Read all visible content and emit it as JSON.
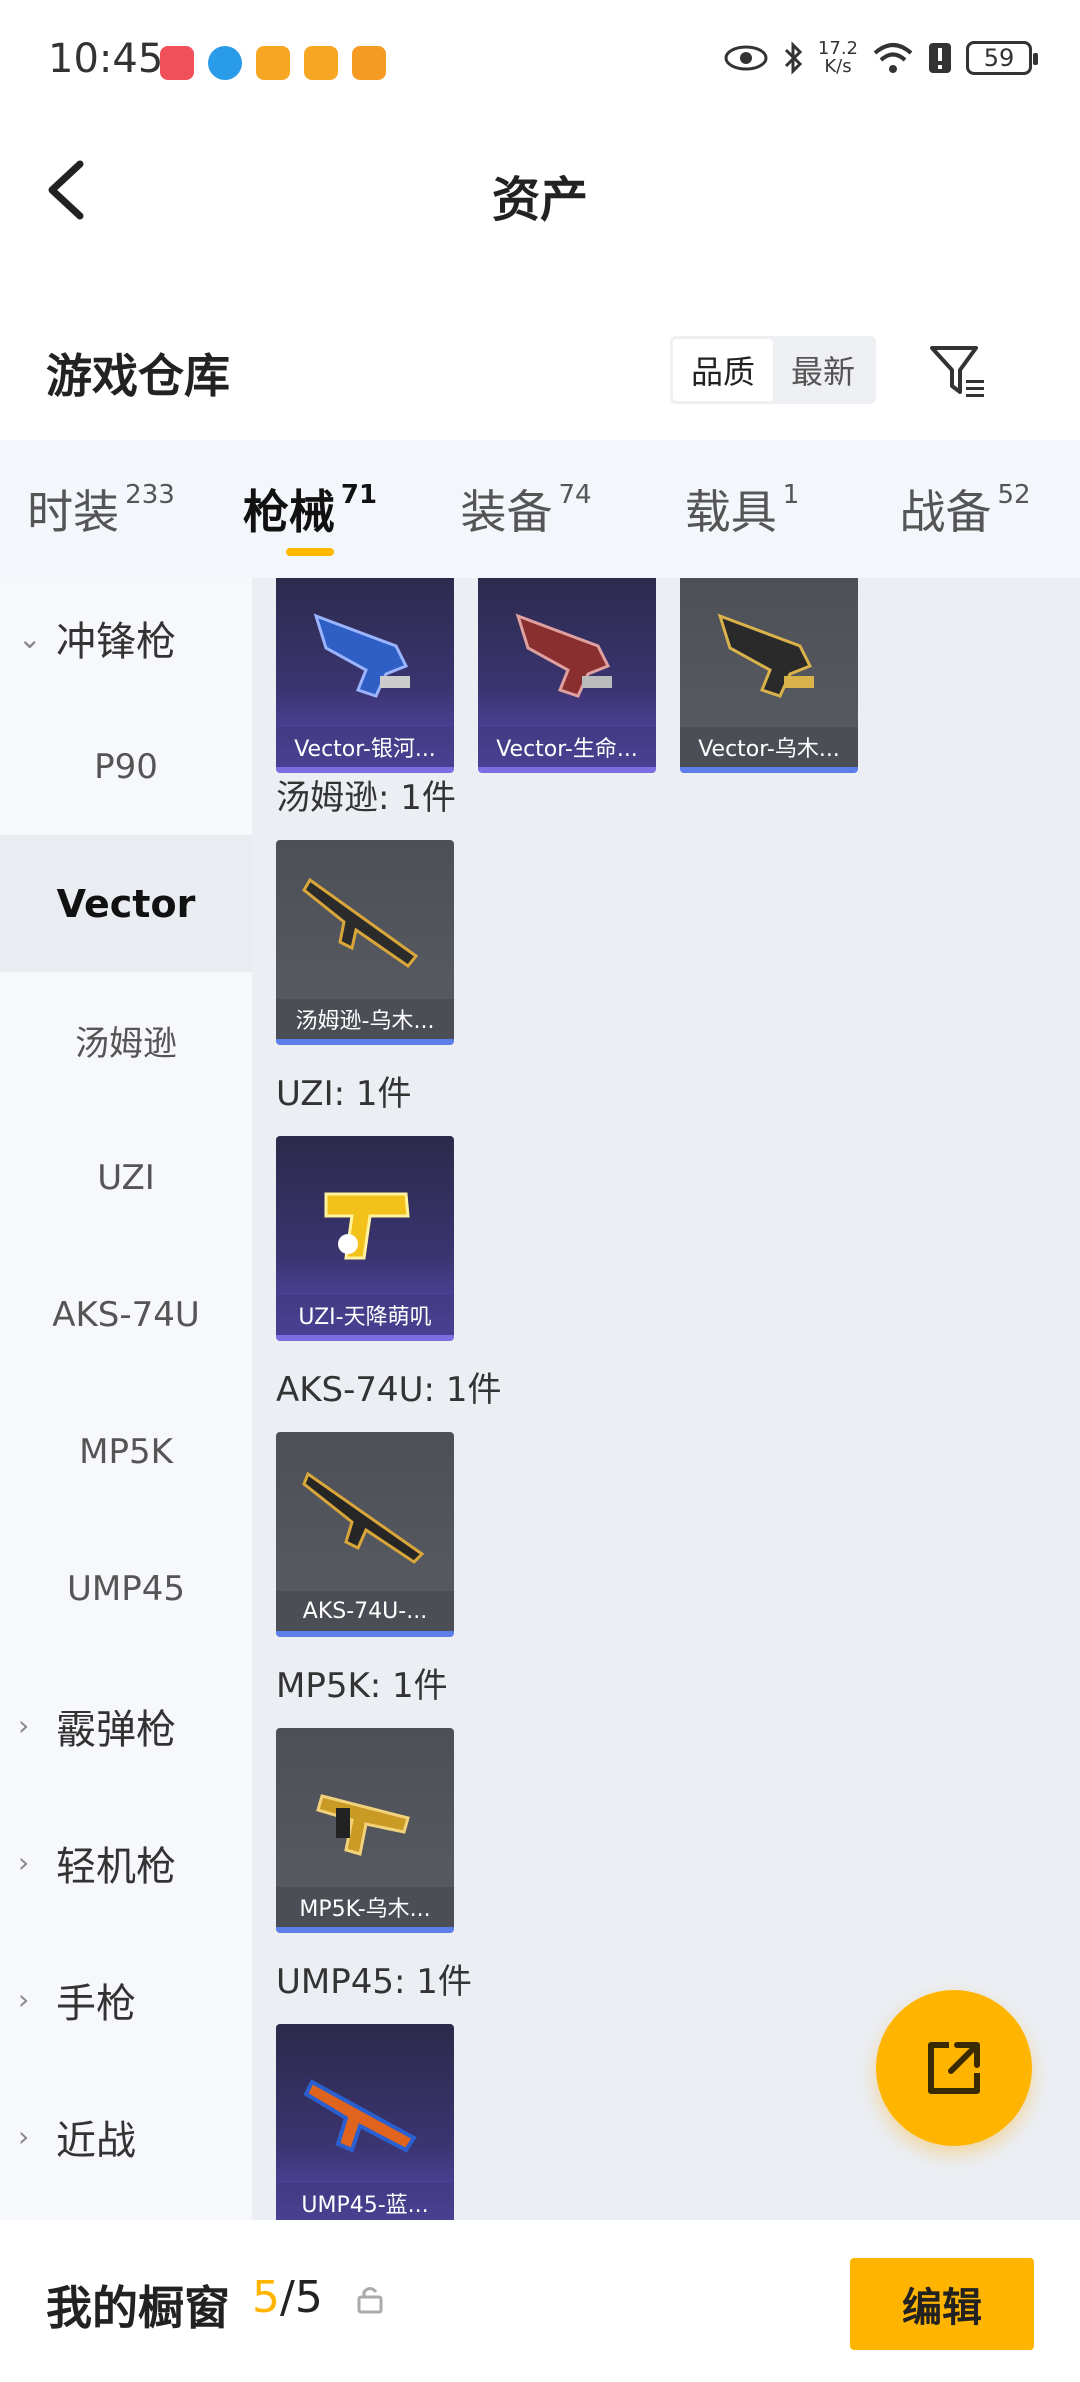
{
  "status_bar": {
    "time": "10:45",
    "net_speed_value": "17.2",
    "net_speed_unit": "K/s",
    "battery": "59"
  },
  "header": {
    "title": "资产"
  },
  "warehouse": {
    "title": "游戏仓库",
    "sort_options": [
      "品质",
      "最新"
    ],
    "active_sort": "品质"
  },
  "tabs": [
    {
      "label": "时装",
      "count": "233"
    },
    {
      "label": "枪械",
      "count": "71",
      "active": true
    },
    {
      "label": "装备",
      "count": "74"
    },
    {
      "label": "载具",
      "count": "1"
    },
    {
      "label": "战备",
      "count": "52"
    }
  ],
  "sidebar": {
    "items": [
      {
        "label": "冲锋枪",
        "type": "group",
        "expanded": true
      },
      {
        "label": "P90"
      },
      {
        "label": "Vector",
        "active": true
      },
      {
        "label": "汤姆逊"
      },
      {
        "label": "UZI"
      },
      {
        "label": "AKS-74U"
      },
      {
        "label": "MP5K"
      },
      {
        "label": "UMP45"
      },
      {
        "label": "霰弹枪",
        "type": "group"
      },
      {
        "label": "轻机枪",
        "type": "group"
      },
      {
        "label": "手枪",
        "type": "group"
      },
      {
        "label": "近战",
        "type": "group"
      }
    ]
  },
  "content": {
    "vector_cards": [
      "Vector-银河...",
      "Vector-生命...",
      "Vector-乌木..."
    ],
    "sections": [
      {
        "label": "汤姆逊: 1件",
        "card": "汤姆逊-乌木..."
      },
      {
        "label": "UZI: 1件",
        "card": "UZI-天降萌叽"
      },
      {
        "label": "AKS-74U: 1件",
        "card": "AKS-74U-..."
      },
      {
        "label": "MP5K: 1件",
        "card": "MP5K-乌木..."
      },
      {
        "label": "UMP45: 1件",
        "card": "UMP45-蓝..."
      }
    ]
  },
  "bottom_bar": {
    "label": "我的橱窗",
    "current": "5",
    "separator": "/",
    "total": "5",
    "edit_label": "编辑"
  },
  "colors": {
    "accent": "#ffb400",
    "purple_card": "#3a3470",
    "gray_card": "#5a5c64"
  }
}
